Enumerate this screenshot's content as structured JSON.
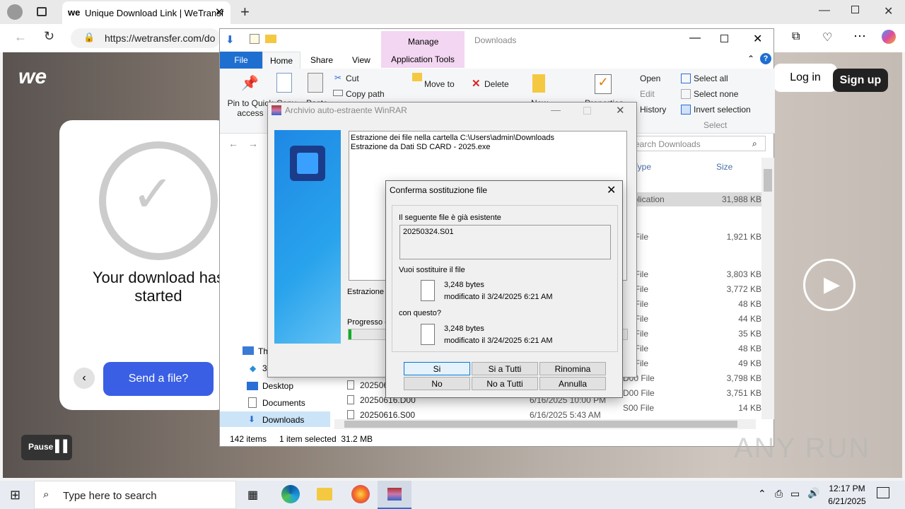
{
  "browser": {
    "tab_title": "Unique Download Link | WeTransf",
    "url": "https://wetransfer.com/do"
  },
  "wetransfer": {
    "logo": "we",
    "login": "Log in",
    "signup": "Sign up",
    "download_started": "Your download has started",
    "send": "Send a file?",
    "pause": "Pause"
  },
  "explorer": {
    "context_tab": "Manage",
    "window_title": "Downloads",
    "tabs": [
      "File",
      "Home",
      "Share",
      "View",
      "Application Tools"
    ],
    "ribbon": {
      "pin": "Pin to Quick access",
      "copy": "Copy",
      "paste": "Paste",
      "cut": "Cut",
      "copy_path": "Copy path",
      "move_to": "Move to",
      "delete": "Delete",
      "new": "New",
      "properties": "Properties",
      "open": "Open",
      "edit": "Edit",
      "history": "History",
      "select_all": "Select all",
      "select_none": "Select none",
      "invert": "Invert selection",
      "select_group": "Select"
    },
    "search_placeholder": "Search Downloads",
    "col_type": "Type",
    "col_size": "Size",
    "nav": [
      "Thi",
      "3D",
      "Desktop",
      "Documents",
      "Downloads"
    ],
    "right_rows": [
      {
        "type": "Application",
        "size": "31,988 KB"
      },
      {
        "type": "00 File",
        "size": "1,921 KB"
      },
      {
        "type": "00 File",
        "size": "3,803 KB"
      },
      {
        "type": "00 File",
        "size": "3,772 KB"
      },
      {
        "type": "04 File",
        "size": "48 KB"
      },
      {
        "type": "03 File",
        "size": "44 KB"
      },
      {
        "type": "02 File",
        "size": "35 KB"
      },
      {
        "type": "01 File",
        "size": "48 KB"
      },
      {
        "type": "00 File",
        "size": "49 KB"
      },
      {
        "type": "D00 File",
        "size": "3,798 KB"
      },
      {
        "type": "D00 File",
        "size": "3,751 KB"
      },
      {
        "type": "S00 File",
        "size": "14 KB"
      }
    ],
    "files": [
      {
        "name": "2025061",
        "date": "",
        "type": ""
      },
      {
        "name": "20250616.D00",
        "date": "6/16/2025 10:00 PM",
        "type": ""
      },
      {
        "name": "20250616.S00",
        "date": "6/16/2025 5:43 AM",
        "type": ""
      }
    ],
    "status_items": "142 items",
    "status_selected": "1 item selected  31.2 MB"
  },
  "winrar": {
    "title": "Archivio auto-estraente WinRAR",
    "log1": "Estrazione dei file nella cartella C:\\Users\\admin\\Downloads",
    "log2": "Estrazione da Dati SD CARD - 2025.exe",
    "extracting": "Estrazione c",
    "progress": "Progresso e"
  },
  "dialog": {
    "title": "Conferma sostituzione file",
    "exists": "Il seguente file è già esistente",
    "filename": "20250324.S01",
    "replace_q": "Vuoi sostituire il file",
    "size1": "3,248 bytes",
    "mod1": "modificato il 3/24/2025 6:21 AM",
    "with": "con questo?",
    "size2": "3,248 bytes",
    "mod2": "modificato il 3/24/2025 6:21 AM",
    "buttons": {
      "si": "Si",
      "si_tutti": "Si a Tutti",
      "rinomina": "Rinomina",
      "no": "No",
      "no_tutti": "No a Tutti",
      "annulla": "Annulla"
    }
  },
  "taskbar": {
    "search": "Type here to search",
    "time": "12:17 PM",
    "date": "6/21/2025"
  },
  "watermark": "ANY RUN"
}
